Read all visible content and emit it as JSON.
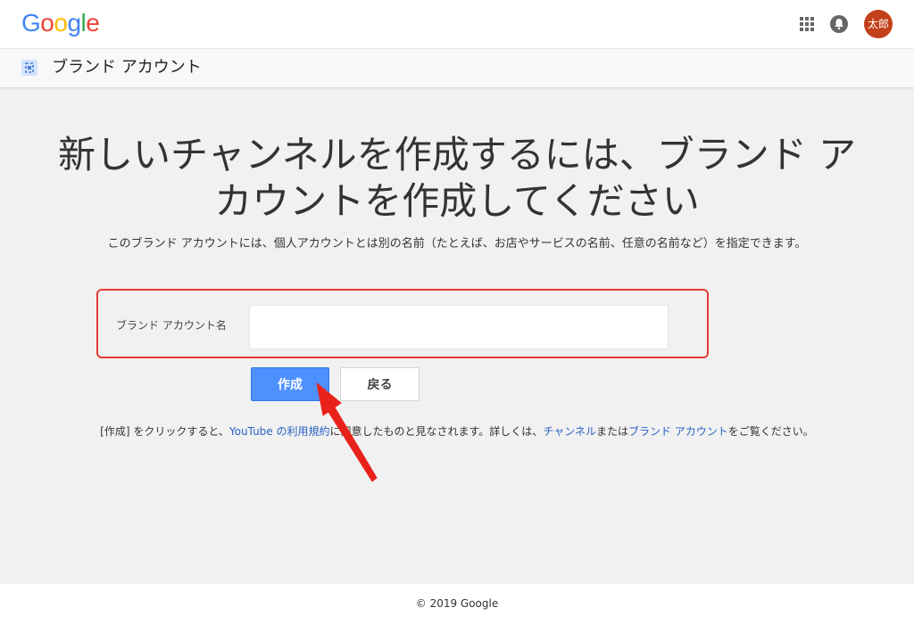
{
  "header": {
    "logo_letters": [
      {
        "char": "G",
        "color": "#4285F4"
      },
      {
        "char": "o",
        "color": "#EA4335"
      },
      {
        "char": "o",
        "color": "#FBBC05"
      },
      {
        "char": "g",
        "color": "#4285F4"
      },
      {
        "char": "l",
        "color": "#34A853"
      },
      {
        "char": "e",
        "color": "#EA4335"
      }
    ],
    "apps_icon": "grid-apps-icon",
    "notification_icon": "bell-icon",
    "avatar_text": "太郎",
    "avatar_color": "#c2401a"
  },
  "subheader": {
    "icon": "brand-account-icon",
    "title": "ブランド アカウント"
  },
  "main": {
    "heading_line1": "新しいチャンネルを作成するには、ブランド ア",
    "heading_line2": "カウントを作成してください",
    "description": "このブランド アカウントには、個人アカウントとは別の名前（たとえば、お店やサービスの名前、任意の名前など）を指定できます。",
    "field_label": "ブランド アカウント名",
    "field_value": "",
    "field_placeholder": "",
    "create_label": "作成",
    "back_label": "戻る",
    "terms_prefix": "[作成] をクリックすると、",
    "terms_link1": "YouTube の利用規約",
    "terms_middle": "に同意したものと見なされます。詳しくは、",
    "terms_link2": "チャンネル",
    "terms_connector": "または",
    "terms_link3": "ブランド アカウント",
    "terms_suffix": "をご覧ください。"
  },
  "footer": {
    "copyright": "© 2019 Google"
  },
  "colors": {
    "accent": "#4d90fe",
    "highlight": "#e53935",
    "link": "#2962c4"
  }
}
